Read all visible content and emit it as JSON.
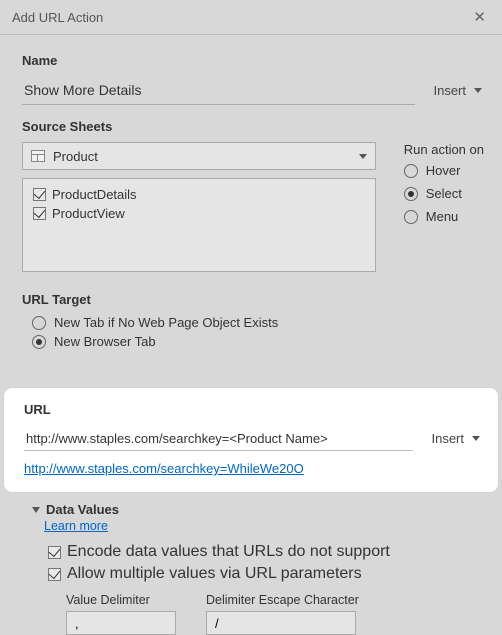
{
  "dialog": {
    "title": "Add URL Action"
  },
  "name": {
    "label": "Name",
    "value": "Show More Details",
    "insert_label": "Insert"
  },
  "source": {
    "label": "Source Sheets",
    "dropdown_value": "Product",
    "sheets": [
      {
        "label": "ProductDetails",
        "checked": true
      },
      {
        "label": "ProductView",
        "checked": true
      }
    ],
    "runaction_label": "Run action on",
    "runaction_options": [
      {
        "label": "Hover",
        "selected": false
      },
      {
        "label": "Select",
        "selected": true
      },
      {
        "label": "Menu",
        "selected": false
      }
    ]
  },
  "target": {
    "label": "URL Target",
    "options": [
      {
        "label": "New Tab if No Web Page Object Exists",
        "selected": false
      },
      {
        "label": "New Browser Tab",
        "selected": true
      }
    ]
  },
  "url": {
    "label": "URL",
    "value": "http://www.staples.com/searchkey=<Product Name>",
    "insert_label": "Insert",
    "preview": "http://www.staples.com/searchkey=WhileWe20O"
  },
  "datavalues": {
    "label": "Data Values",
    "learnmore": "Learn more",
    "opt_encode": "Encode data values that URLs do not support",
    "opt_multi": "Allow multiple values via URL parameters",
    "value_delim_label": "Value Delimiter",
    "value_delim": ",",
    "escape_label": "Delimiter Escape Character",
    "escape_value": "/"
  }
}
